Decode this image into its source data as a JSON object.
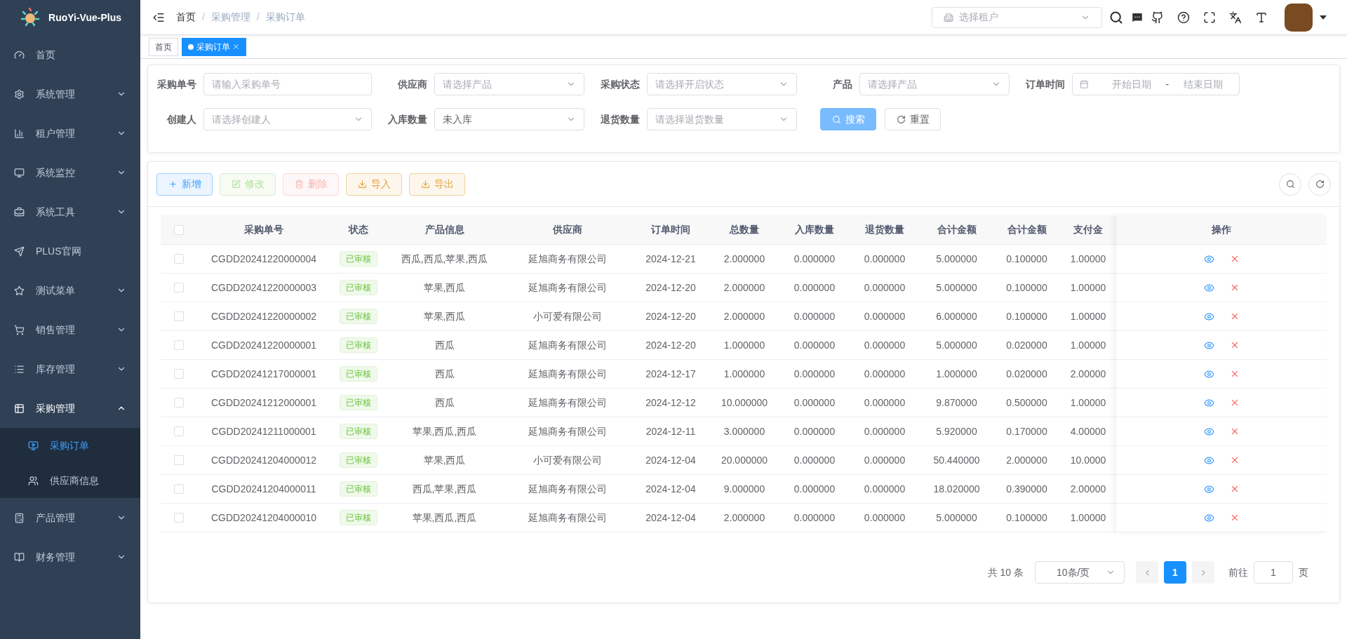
{
  "brand": {
    "title": "RuoYi-Vue-Plus"
  },
  "sidebar": {
    "items": [
      {
        "label": "首页",
        "kind": "link"
      },
      {
        "label": "系统管理",
        "kind": "submenu",
        "expanded": false
      },
      {
        "label": "租户管理",
        "kind": "submenu",
        "expanded": false
      },
      {
        "label": "系统监控",
        "kind": "submenu",
        "expanded": false
      },
      {
        "label": "系统工具",
        "kind": "submenu",
        "expanded": false
      },
      {
        "label": "PLUS官网",
        "kind": "link"
      },
      {
        "label": "测试菜单",
        "kind": "submenu",
        "expanded": false
      },
      {
        "label": "销售管理",
        "kind": "submenu",
        "expanded": false
      },
      {
        "label": "库存管理",
        "kind": "submenu",
        "expanded": false
      },
      {
        "label": "采购管理",
        "kind": "submenu",
        "expanded": true,
        "children": [
          {
            "label": "采购订单",
            "selected": true
          },
          {
            "label": "供应商信息",
            "selected": false
          }
        ]
      },
      {
        "label": "产品管理",
        "kind": "submenu",
        "expanded": false
      },
      {
        "label": "财务管理",
        "kind": "submenu",
        "expanded": false
      }
    ]
  },
  "breadcrumb_separator": "/",
  "breadcrumb": [
    {
      "label": "首页",
      "current": false
    },
    {
      "label": "采购管理",
      "current": true
    },
    {
      "label": "采购订单",
      "current": true
    }
  ],
  "tenant_select": {
    "placeholder": "选择租户"
  },
  "tags": [
    {
      "label": "首页",
      "selected": false
    },
    {
      "label": "采购订单",
      "selected": true
    }
  ],
  "filters": [
    [
      {
        "label": "采购单号",
        "kind": "input",
        "placeholder": "请输入采购单号"
      },
      {
        "label": "供应商",
        "kind": "select",
        "placeholder": "请选择产品"
      },
      {
        "label": "采购状态",
        "kind": "select",
        "placeholder": "请选择开启状态"
      },
      {
        "label": "产品",
        "kind": "select",
        "placeholder": "请选择产品"
      },
      {
        "label": "订单时间",
        "kind": "daterange",
        "placeholder": "开始日期",
        "separator": "-",
        "placeholder_end": "结束日期"
      }
    ],
    [
      {
        "label": "创建人",
        "kind": "select",
        "placeholder": "请选择创建人"
      },
      {
        "label": "入库数量",
        "kind": "select",
        "value": "未入库"
      },
      {
        "label": "退货数量",
        "kind": "select",
        "placeholder": "请选择退货数量"
      }
    ]
  ],
  "filter_buttons": [
    {
      "label": "搜索",
      "kind": "primary"
    },
    {
      "label": "重置",
      "kind": "default"
    }
  ],
  "toolbar": [
    {
      "label": "新增",
      "kind": "primary",
      "disabled": false
    },
    {
      "label": "修改",
      "kind": "success",
      "disabled": true
    },
    {
      "label": "删除",
      "kind": "danger",
      "disabled": true
    },
    {
      "label": "导入",
      "kind": "warning",
      "disabled": false
    },
    {
      "label": "导出",
      "kind": "warning",
      "disabled": false
    }
  ],
  "table": {
    "all_checked": false,
    "columns": [
      "采购单号",
      "状态",
      "产品信息",
      "供应商",
      "订单时间",
      "总数量",
      "入库数量",
      "退货数量",
      "合计金额",
      "合计金额",
      "支付金"
    ],
    "action_column": "操作",
    "rows": [
      {
        "checked": false,
        "cells": [
          "CGDD20241220000004",
          "已审核",
          "西瓜,西瓜,苹果,西瓜",
          "延旭商务有限公司",
          "2024-12-21",
          "2.000000",
          "0.000000",
          "0.000000",
          "5.000000",
          "0.100000",
          "1.00000"
        ]
      },
      {
        "checked": false,
        "cells": [
          "CGDD20241220000003",
          "已审核",
          "苹果,西瓜",
          "延旭商务有限公司",
          "2024-12-20",
          "2.000000",
          "0.000000",
          "0.000000",
          "5.000000",
          "0.100000",
          "1.00000"
        ]
      },
      {
        "checked": false,
        "cells": [
          "CGDD20241220000002",
          "已审核",
          "苹果,西瓜",
          "小可爱有限公司",
          "2024-12-20",
          "2.000000",
          "0.000000",
          "0.000000",
          "6.000000",
          "0.100000",
          "1.00000"
        ]
      },
      {
        "checked": false,
        "cells": [
          "CGDD20241220000001",
          "已审核",
          "西瓜",
          "延旭商务有限公司",
          "2024-12-20",
          "1.000000",
          "0.000000",
          "0.000000",
          "5.000000",
          "0.020000",
          "1.00000"
        ]
      },
      {
        "checked": false,
        "cells": [
          "CGDD20241217000001",
          "已审核",
          "西瓜",
          "延旭商务有限公司",
          "2024-12-17",
          "1.000000",
          "0.000000",
          "0.000000",
          "1.000000",
          "0.020000",
          "2.00000"
        ]
      },
      {
        "checked": false,
        "cells": [
          "CGDD20241212000001",
          "已审核",
          "西瓜",
          "延旭商务有限公司",
          "2024-12-12",
          "10.000000",
          "0.000000",
          "0.000000",
          "9.870000",
          "0.500000",
          "1.00000"
        ]
      },
      {
        "checked": false,
        "cells": [
          "CGDD20241211000001",
          "已审核",
          "苹果,西瓜,西瓜",
          "延旭商务有限公司",
          "2024-12-11",
          "3.000000",
          "0.000000",
          "0.000000",
          "5.920000",
          "0.170000",
          "4.00000"
        ]
      },
      {
        "checked": false,
        "cells": [
          "CGDD20241204000012",
          "已审核",
          "苹果,西瓜",
          "小可爱有限公司",
          "2024-12-04",
          "20.000000",
          "0.000000",
          "0.000000",
          "50.440000",
          "2.000000",
          "10.0000"
        ]
      },
      {
        "checked": false,
        "cells": [
          "CGDD20241204000011",
          "已审核",
          "西瓜,苹果,西瓜",
          "延旭商务有限公司",
          "2024-12-04",
          "9.000000",
          "0.000000",
          "0.000000",
          "18.020000",
          "0.390000",
          "2.00000"
        ]
      },
      {
        "checked": false,
        "cells": [
          "CGDD20241204000010",
          "已审核",
          "苹果,西瓜,西瓜",
          "延旭商务有限公司",
          "2024-12-04",
          "2.000000",
          "0.000000",
          "0.000000",
          "5.000000",
          "0.100000",
          "1.00000"
        ]
      }
    ]
  },
  "pagination": {
    "total": "共 10 条",
    "page_size": "10条/页",
    "pages": [
      {
        "label": "1",
        "selected": true
      }
    ],
    "goto_label": "前往",
    "goto_value": "1",
    "goto_suffix": "页"
  }
}
